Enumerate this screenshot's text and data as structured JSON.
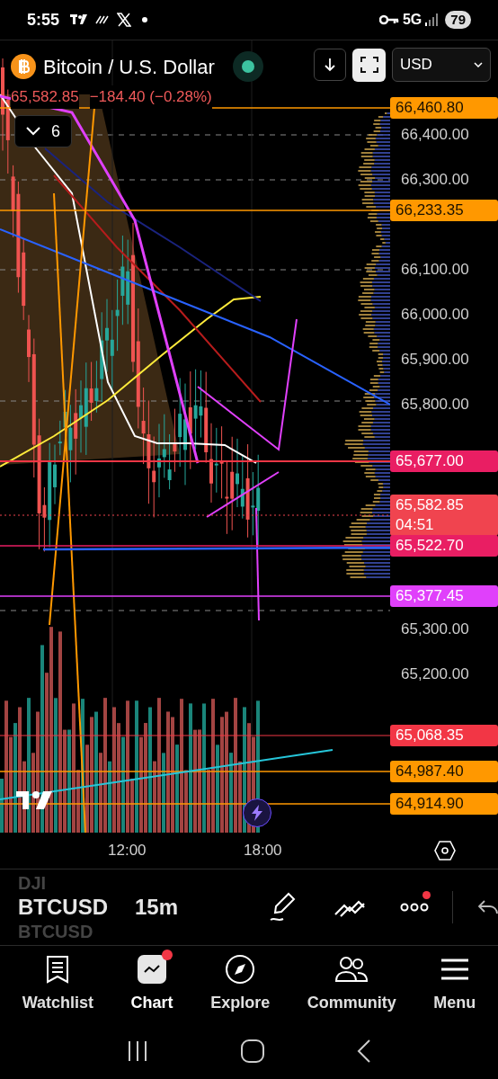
{
  "status_bar": {
    "time": "5:55",
    "network": "5G",
    "battery": "79"
  },
  "header": {
    "title": "Bitcoin / U.S. Dollar",
    "currency": "USD",
    "price": "65,582.85",
    "change": "−184.40 (−0.28%)",
    "indicator_count": "6"
  },
  "price_axis": {
    "ticks": [
      "66,400.00",
      "66,300.00",
      "66,100.00",
      "66,000.00",
      "65,900.00",
      "65,800.00",
      "65,300.00",
      "65,200.00"
    ],
    "tags": [
      {
        "text": "66,460.80",
        "color": "#ff9800"
      },
      {
        "text": "66,233.35",
        "color": "#ff9800"
      },
      {
        "text": "65,677.00",
        "color": "#e91e63"
      },
      {
        "text": "65,582.85",
        "countdown": "04:51",
        "color": "#f0444f"
      },
      {
        "text": "65,522.70",
        "color": "#e91e63"
      },
      {
        "text": "65,377.45",
        "color": "#e040fb"
      },
      {
        "text": "65,068.35",
        "color": "#f23645"
      },
      {
        "text": "64,987.40",
        "color": "#ff9800"
      },
      {
        "text": "64,914.90",
        "color": "#ff9800"
      }
    ]
  },
  "time_axis": [
    "12:00",
    "18:00"
  ],
  "toolbar": {
    "symbols": [
      {
        "text": "DJI",
        "selected": false
      },
      {
        "text": "BTCUSD",
        "selected": true
      },
      {
        "text": "BTCUSD",
        "selected": false
      }
    ],
    "interval": "15m",
    "more_notification": true
  },
  "nav": [
    {
      "label": "Watchlist",
      "kind": "watchlist",
      "selected": false,
      "badge": false
    },
    {
      "label": "Chart",
      "kind": "chart",
      "selected": true,
      "badge": true
    },
    {
      "label": "Explore",
      "kind": "explore",
      "selected": false,
      "badge": false
    },
    {
      "label": "Community",
      "kind": "community",
      "selected": false,
      "badge": false
    },
    {
      "label": "Menu",
      "kind": "menu",
      "selected": false,
      "badge": false
    }
  ]
}
